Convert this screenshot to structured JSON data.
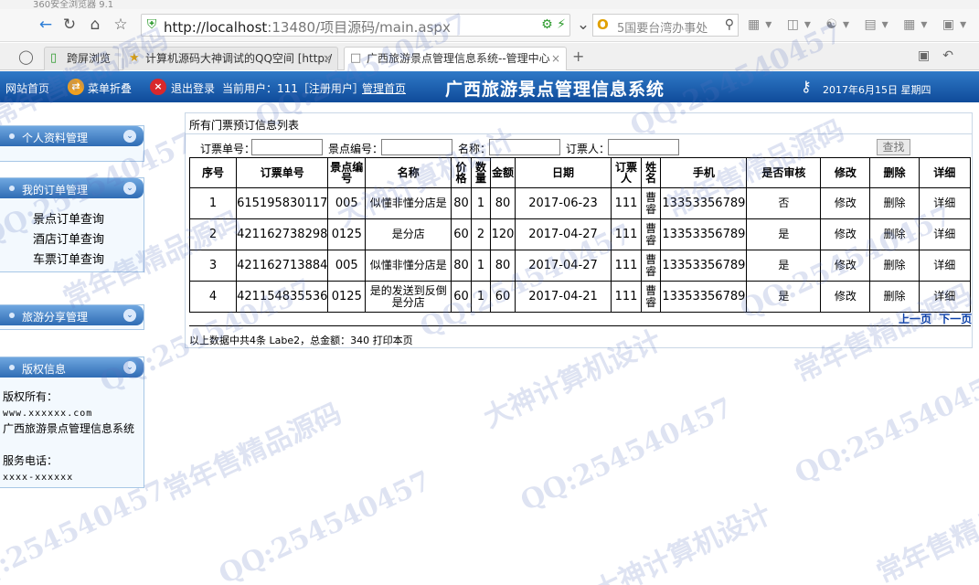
{
  "browser": {
    "window_title": "360安全浏览器 9.1",
    "url_host": "http://localhost",
    "url_rest": ":13480/项目源码/main.aspx",
    "search_text": "5国要台湾办事处",
    "tabs": [
      {
        "icon": "phone-icon",
        "label": "跨屏浏览"
      },
      {
        "icon": "star-icon",
        "label": "计算机源码大神调试的QQ空间 [http:/"
      },
      {
        "icon": "page-icon",
        "label": "广西旅游景点管理信息系统--管理中心"
      }
    ]
  },
  "header": {
    "home_link": "网站首页",
    "collapse_menu": "菜单折叠",
    "logout": "退出登录",
    "current_user": "当前用户：111［注册用户］",
    "admin_home": "管理首页",
    "title": "广西旅游景点管理信息系统",
    "date": "2017年6月15日 星期四"
  },
  "sidebar": {
    "panels": [
      {
        "label": "个人资料管理",
        "items": []
      },
      {
        "label": "我的订单管理",
        "items": [
          "景点订单查询",
          "酒店订单查询",
          "车票订单查询"
        ]
      },
      {
        "label": "旅游分享管理",
        "items": []
      },
      {
        "label": "版权信息",
        "items": []
      }
    ],
    "copyright": {
      "owner_label": "版权所有：",
      "site": "www.xxxxxx.com",
      "system_name": "广西旅游景点管理信息系统",
      "phone_label": "服务电话：",
      "phone": "xxxx-xxxxxx"
    }
  },
  "main": {
    "caption": "所有门票预订信息列表",
    "filters": {
      "order_no_label": "订票单号：",
      "spot_no_label": "景点编号：",
      "name_label": "名称：",
      "booker_label": "订票人：",
      "search_button": "查找"
    },
    "table": {
      "headers": [
        "序号",
        "订票单号",
        "景点编号",
        "名称",
        "价格",
        "数量",
        "金额",
        "日期",
        "订票人",
        "姓名",
        "手机",
        "是否审核",
        "修改",
        "删除",
        "详细"
      ],
      "rows": [
        [
          "1",
          "615195830117",
          "005",
          "似懂非懂分店是",
          "80",
          "1",
          "80",
          "2017-06-23",
          "111",
          "曹睿",
          "13353356789",
          "否",
          "修改",
          "删除",
          "详细"
        ],
        [
          "2",
          "421162738298",
          "0125",
          "是分店",
          "60",
          "2",
          "120",
          "2017-04-27",
          "111",
          "曹睿",
          "13353356789",
          "是",
          "修改",
          "删除",
          "详细"
        ],
        [
          "3",
          "421162713884",
          "005",
          "似懂非懂分店是",
          "80",
          "1",
          "80",
          "2017-04-27",
          "111",
          "曹睿",
          "13353356789",
          "是",
          "修改",
          "删除",
          "详细"
        ],
        [
          "4",
          "421154835536",
          "0125",
          "是的发送到反倒是分店",
          "60",
          "1",
          "60",
          "2017-04-21",
          "111",
          "曹睿",
          "13353356789",
          "是",
          "修改",
          "删除",
          "详细"
        ]
      ]
    },
    "pager": {
      "prev": "上一页",
      "next": "下一页"
    },
    "summary": "以上数据中共4条 Labe2，总金额：340 打印本页"
  },
  "watermarks": [
    "常年售精品源码",
    "QQ:254540457",
    "大神计算机设计"
  ],
  "colors": {
    "header_blue": "#1a5aa8",
    "panel_blue": "#3c7cc4",
    "link_blue": "#0a3fa8"
  }
}
